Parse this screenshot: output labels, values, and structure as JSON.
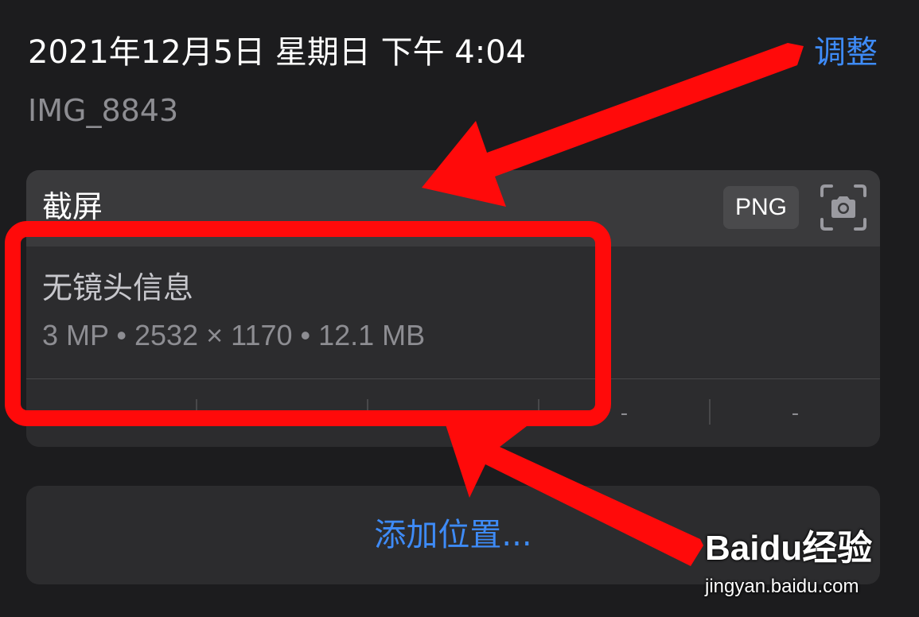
{
  "header": {
    "datetime": "2021年12月5日 星期日 下午 4:04",
    "adjust_label": "调整",
    "filename": "IMG_8843"
  },
  "info_card": {
    "title": "截屏",
    "format_badge": "PNG",
    "camera_icon": "screenshot-camera-icon",
    "lens_info": "无镜头信息",
    "specs": "3 MP • 2532 × 1170 • 12.1 MB",
    "exif_values": [
      "-",
      "-",
      "-",
      "-",
      "-"
    ]
  },
  "location": {
    "label": "添加位置..."
  },
  "watermark": {
    "logo_text": "Baidu经验",
    "url": "jingyan.baidu.com"
  },
  "colors": {
    "background": "#1c1c1e",
    "card": "#2c2c2e",
    "accent": "#3e8bf7",
    "annotation": "#ff0a0a"
  }
}
